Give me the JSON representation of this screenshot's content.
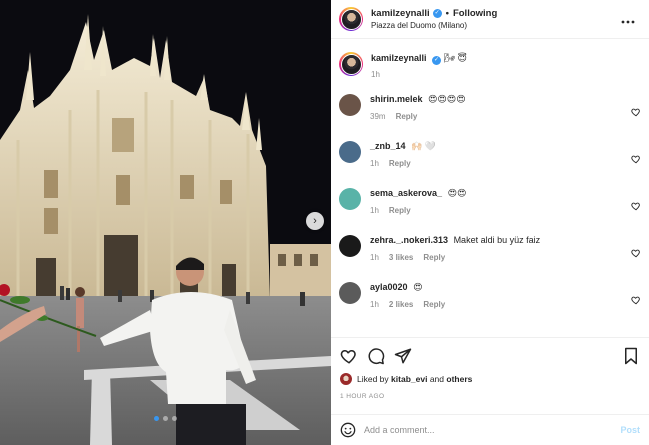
{
  "post": {
    "username": "kamilzeynalli",
    "verified_mark": "✓",
    "separator": "•",
    "follow_label": "Following",
    "location": "Piazza del Duomo (Milano)",
    "more_icon": "more-horizontal-icon",
    "carousel": {
      "next_arrow": "›",
      "dot_count": 3,
      "active_dot_index": 0
    }
  },
  "caption": {
    "username": "kamilzeynalli",
    "text": "🌬 😇",
    "time": "1h"
  },
  "comments": [
    {
      "username": "shirin.melek",
      "text": "😍😍😍😍",
      "time": "39m",
      "likes": "",
      "reply_label": "Reply",
      "avatar_color": "#6a5448"
    },
    {
      "username": "_znb_14",
      "text": "🙌🏻 🤍",
      "time": "1h",
      "likes": "",
      "reply_label": "Reply",
      "avatar_color": "#4a6b8a"
    },
    {
      "username": "sema_askerova_",
      "text": "😍😍",
      "time": "1h",
      "likes": "",
      "reply_label": "Reply",
      "avatar_color": "#59b3a8"
    },
    {
      "username": "zehra._.nokeri.313",
      "text": "Maket aldi bu yüz faiz",
      "time": "1h",
      "likes": "3 likes",
      "reply_label": "Reply",
      "avatar_color": "#1a1a1a"
    },
    {
      "username": "ayla0020",
      "text": "😍",
      "time": "1h",
      "likes": "2 likes",
      "reply_label": "Reply",
      "avatar_color": "#5b5b5b"
    }
  ],
  "actions": {
    "like_icon": "heart-icon",
    "comment_icon": "comment-icon",
    "share_icon": "share-icon",
    "save_icon": "bookmark-icon"
  },
  "liked_by": {
    "prefix": "Liked by",
    "user": "kitab_evi",
    "conj": "and",
    "others": "others"
  },
  "time_ago": "1 HOUR AGO",
  "add_comment": {
    "emoji_icon": "emoji-icon",
    "placeholder": "Add a comment...",
    "post_label": "Post"
  },
  "colors": {
    "accent": "#3897f0",
    "post_disabled": "#b2dffc",
    "muted": "#8e8e8e",
    "text": "#262626"
  }
}
